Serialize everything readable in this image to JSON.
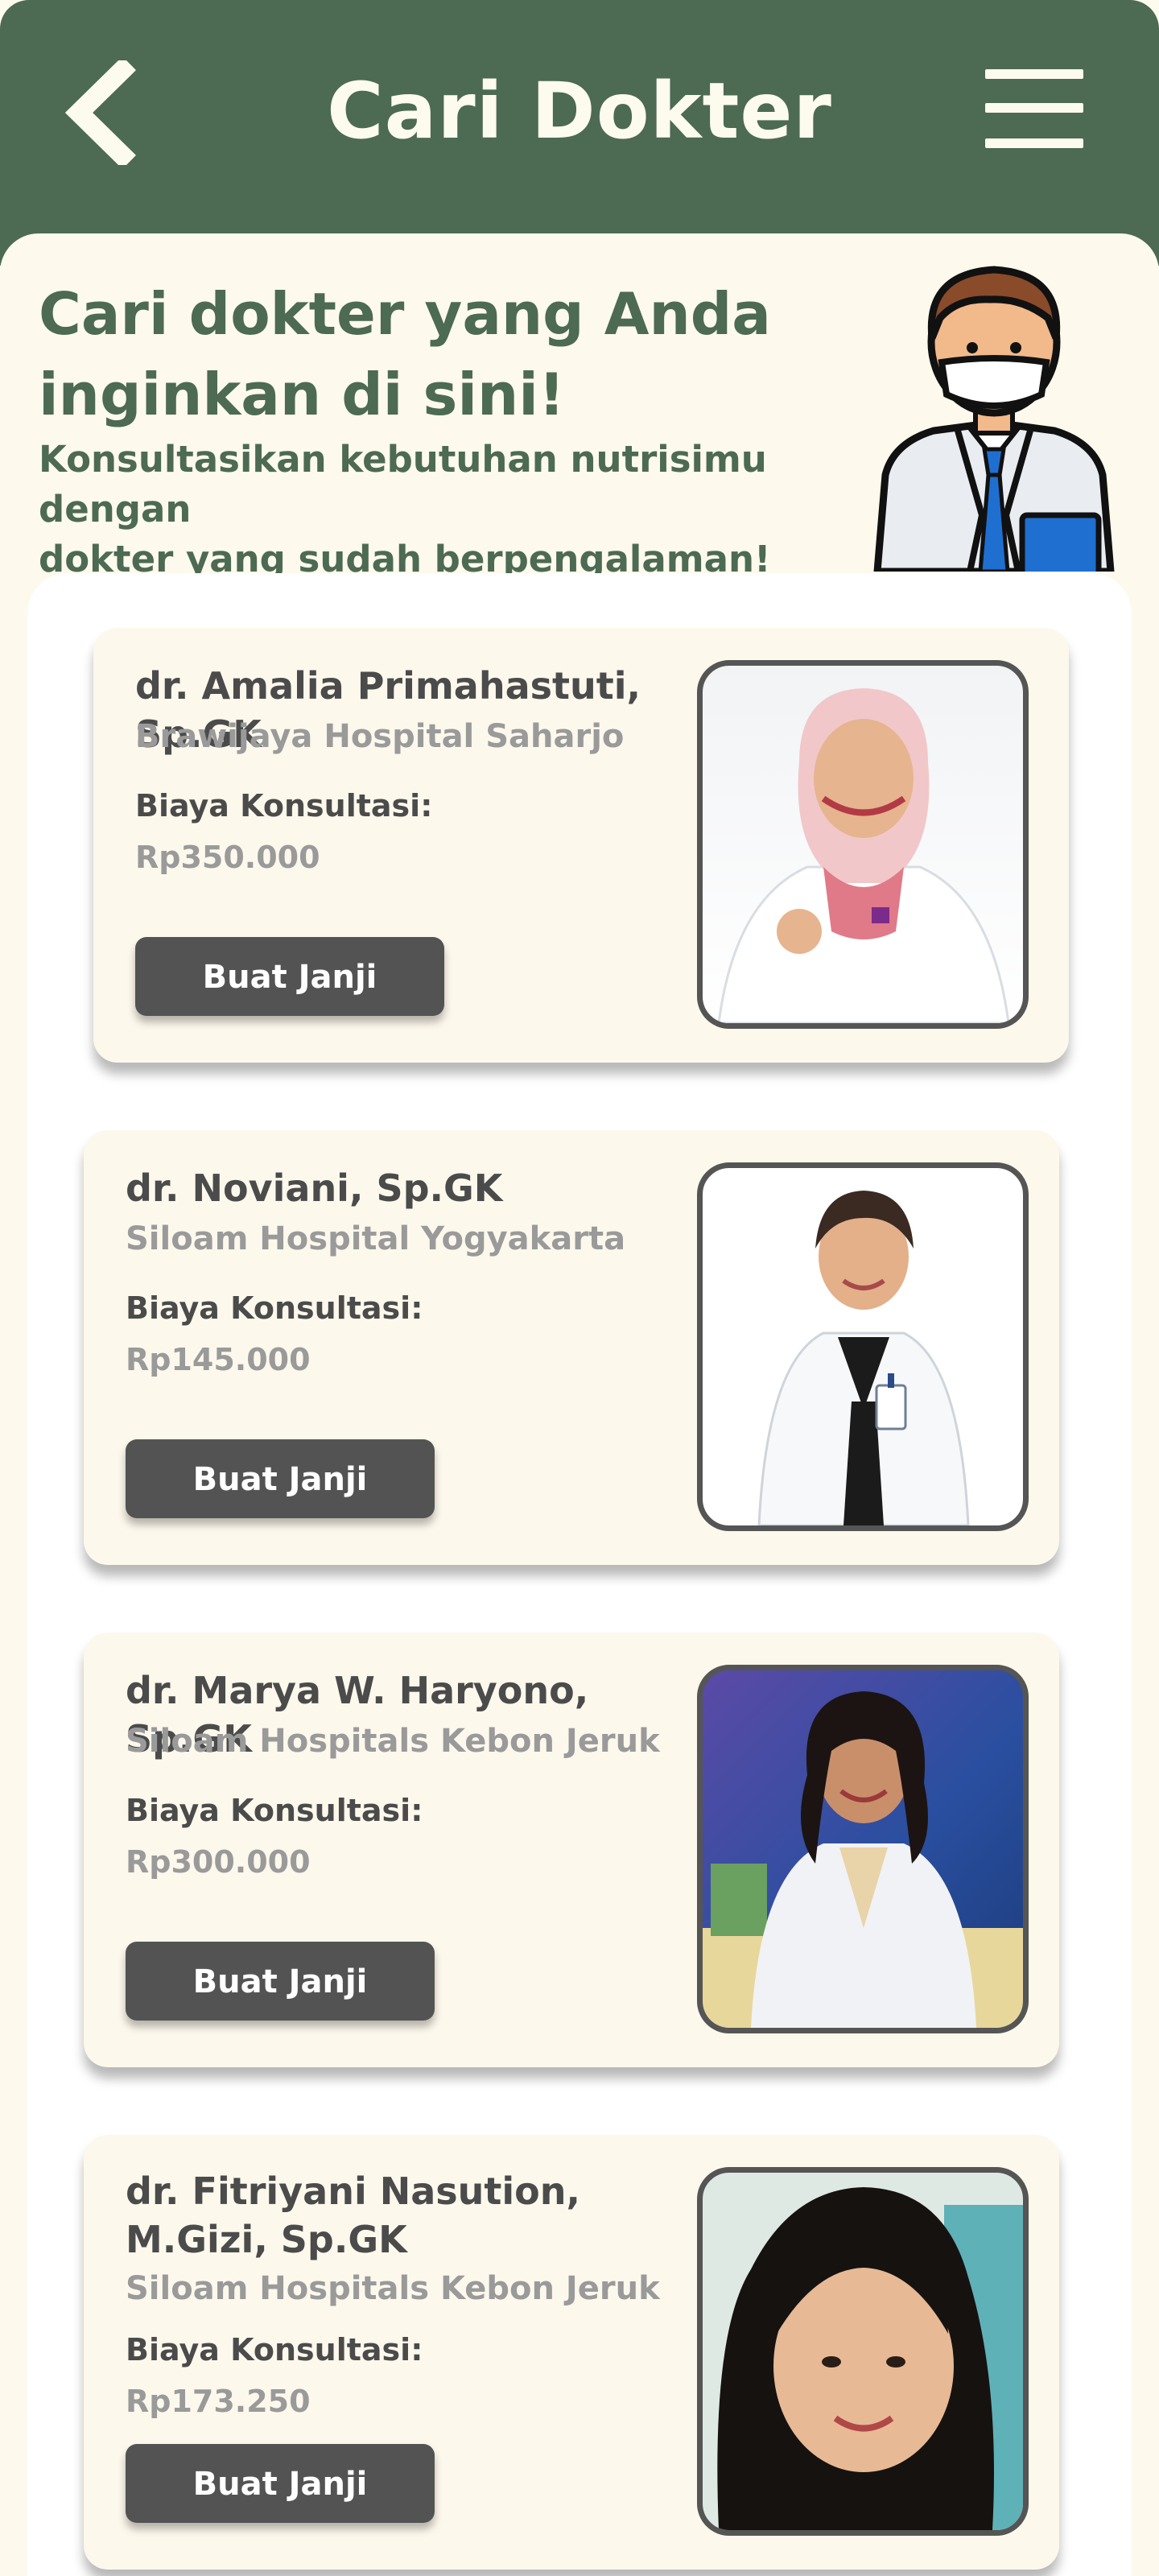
{
  "header": {
    "title": "Cari Dokter"
  },
  "intro": {
    "title_line1": "Cari dokter yang Anda",
    "title_line2": "inginkan di sini!",
    "subtitle_line1": "Konsultasikan kebutuhan nutrisimu dengan",
    "subtitle_line2": "dokter yang sudah berpengalaman!"
  },
  "doctors": [
    {
      "name": "dr. Amalia Primahastuti, Sp.GK",
      "hospital": "Brawijaya Hospital Saharjo",
      "fee_label": "Biaya Konsultasi:",
      "fee": "Rp350.000",
      "button_label": "Buat Janji"
    },
    {
      "name": "dr. Noviani, Sp.GK",
      "hospital": "Siloam Hospital Yogyakarta",
      "fee_label": "Biaya Konsultasi:",
      "fee": "Rp145.000",
      "button_label": "Buat Janji"
    },
    {
      "name": "dr. Marya W. Haryono, Sp.GK",
      "hospital": "Siloam Hospitals Kebon Jeruk",
      "fee_label": "Biaya Konsultasi:",
      "fee": "Rp300.000",
      "button_label": "Buat Janji"
    },
    {
      "name": "dr. Fitriyani Nasution, M.Gizi, Sp.GK",
      "hospital": "Siloam Hospitals Kebon Jeruk",
      "fee_label": "Biaya Konsultasi:",
      "fee": "Rp173.250",
      "button_label": "Buat Janji"
    }
  ],
  "colors": {
    "primary_green": "#4d6a53",
    "cream": "#fdf9ec",
    "button_gray": "#535353",
    "muted_text": "#9a9a9a"
  },
  "icons": {
    "back": "chevron-left-icon",
    "menu": "hamburger-menu-icon"
  }
}
